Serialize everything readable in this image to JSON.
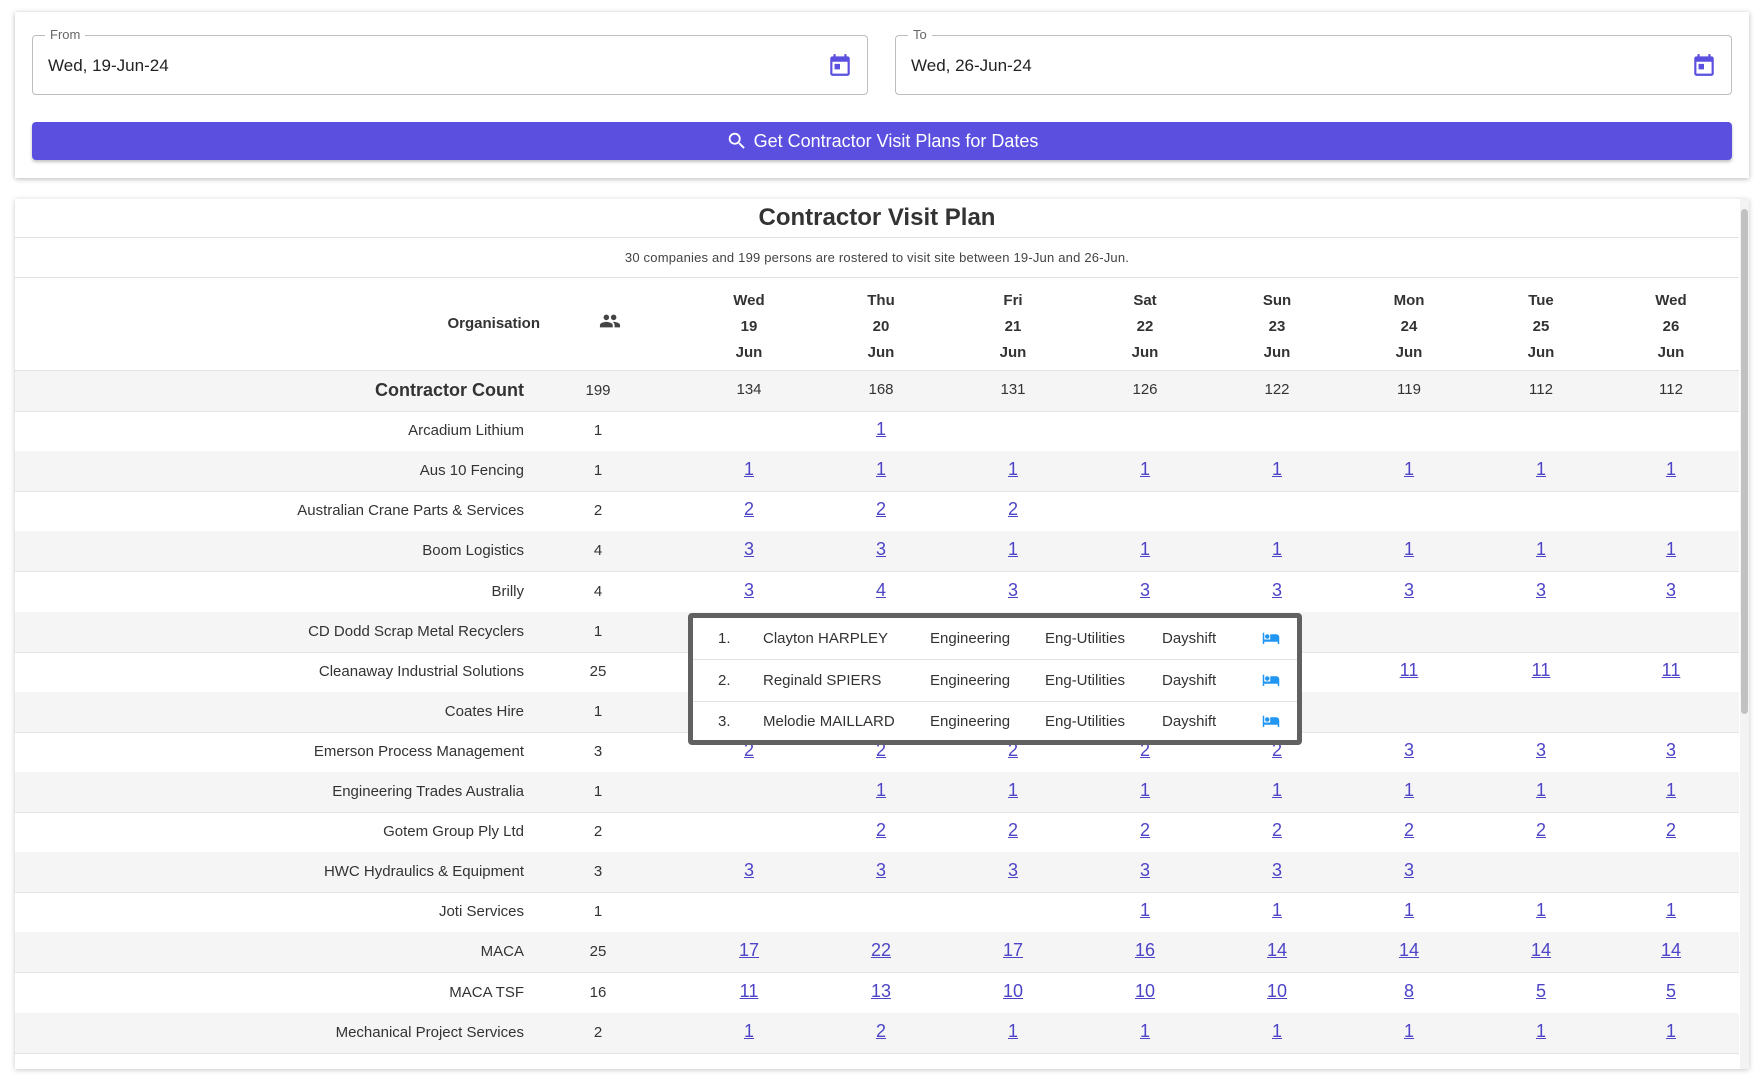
{
  "date_filter": {
    "from_label": "From",
    "from_value": "Wed, 19-Jun-24",
    "to_label": "To",
    "to_value": "Wed, 26-Jun-24",
    "calendar_icon": "calendar-icon",
    "button_label": "Get Contractor Visit Plans for Dates",
    "button_icon": "search-icon",
    "accent_color": "#5b4fe0"
  },
  "plan": {
    "title": "Contractor Visit Plan",
    "summary": "30 companies and 199 persons are rostered to visit site between 19-Jun and 26-Jun.",
    "org_header": "Organisation",
    "people_icon": "people-icon",
    "days": [
      {
        "dow": "Wed",
        "date": "19",
        "month": "Jun"
      },
      {
        "dow": "Thu",
        "date": "20",
        "month": "Jun"
      },
      {
        "dow": "Fri",
        "date": "21",
        "month": "Jun"
      },
      {
        "dow": "Sat",
        "date": "22",
        "month": "Jun"
      },
      {
        "dow": "Sun",
        "date": "23",
        "month": "Jun"
      },
      {
        "dow": "Mon",
        "date": "24",
        "month": "Jun"
      },
      {
        "dow": "Tue",
        "date": "25",
        "month": "Jun"
      },
      {
        "dow": "Wed",
        "date": "26",
        "month": "Jun"
      }
    ],
    "count_row": {
      "label": "Contractor Count",
      "total": "199",
      "values": [
        "134",
        "168",
        "131",
        "126",
        "122",
        "119",
        "112",
        "112"
      ]
    },
    "rows": [
      {
        "org": "Arcadium Lithium",
        "total": "1",
        "values": [
          "",
          "1",
          "",
          "",
          "",
          "",
          "",
          ""
        ]
      },
      {
        "org": "Aus 10 Fencing",
        "total": "1",
        "values": [
          "1",
          "1",
          "1",
          "1",
          "1",
          "1",
          "1",
          "1"
        ]
      },
      {
        "org": "Australian Crane Parts & Services",
        "total": "2",
        "values": [
          "2",
          "2",
          "2",
          "",
          "",
          "",
          "",
          ""
        ]
      },
      {
        "org": "Boom Logistics",
        "total": "4",
        "values": [
          "3",
          "3",
          "1",
          "1",
          "1",
          "1",
          "1",
          "1"
        ]
      },
      {
        "org": "Brilly",
        "total": "4",
        "values": [
          "3",
          "4",
          "3",
          "3",
          "3",
          "3",
          "3",
          "3"
        ]
      },
      {
        "org": "CD Dodd Scrap Metal Recyclers",
        "total": "1",
        "values": [
          "",
          "",
          "",
          "",
          "",
          "",
          "",
          ""
        ]
      },
      {
        "org": "Cleanaway Industrial Solutions",
        "total": "25",
        "values": [
          "",
          "",
          "",
          "",
          "",
          "11",
          "11",
          "11"
        ]
      },
      {
        "org": "Coates Hire",
        "total": "1",
        "values": [
          "",
          "",
          "",
          "",
          "",
          "",
          "",
          ""
        ]
      },
      {
        "org": "Emerson Process Management",
        "total": "3",
        "values": [
          "2",
          "2",
          "2",
          "2",
          "2",
          "3",
          "3",
          "3"
        ]
      },
      {
        "org": "Engineering Trades Australia",
        "total": "1",
        "values": [
          "",
          "1",
          "1",
          "1",
          "1",
          "1",
          "1",
          "1"
        ]
      },
      {
        "org": "Gotem Group Ply Ltd",
        "total": "2",
        "values": [
          "",
          "2",
          "2",
          "2",
          "2",
          "2",
          "2",
          "2"
        ]
      },
      {
        "org": "HWC Hydraulics & Equipment",
        "total": "3",
        "values": [
          "3",
          "3",
          "3",
          "3",
          "3",
          "3",
          "",
          ""
        ]
      },
      {
        "org": "Joti Services",
        "total": "1",
        "values": [
          "",
          "",
          "",
          "1",
          "1",
          "1",
          "1",
          "1"
        ]
      },
      {
        "org": "MACA",
        "total": "25",
        "values": [
          "17",
          "22",
          "17",
          "16",
          "14",
          "14",
          "14",
          "14"
        ]
      },
      {
        "org": "MACA TSF",
        "total": "16",
        "values": [
          "11",
          "13",
          "10",
          "10",
          "10",
          "8",
          "5",
          "5"
        ]
      },
      {
        "org": "Mechanical Project Services",
        "total": "2",
        "values": [
          "1",
          "2",
          "1",
          "1",
          "1",
          "1",
          "1",
          "1"
        ]
      }
    ]
  },
  "popup": {
    "people": [
      {
        "num": "1.",
        "name": "Clayton HARPLEY",
        "dept": "Engineering",
        "sub": "Eng-Utilities",
        "shift": "Dayshift",
        "icon": "bed-icon"
      },
      {
        "num": "2.",
        "name": "Reginald SPIERS",
        "dept": "Engineering",
        "sub": "Eng-Utilities",
        "shift": "Dayshift",
        "icon": "bed-icon"
      },
      {
        "num": "3.",
        "name": "Melodie MAILLARD",
        "dept": "Engineering",
        "sub": "Eng-Utilities",
        "shift": "Dayshift",
        "icon": "bed-icon"
      }
    ]
  }
}
